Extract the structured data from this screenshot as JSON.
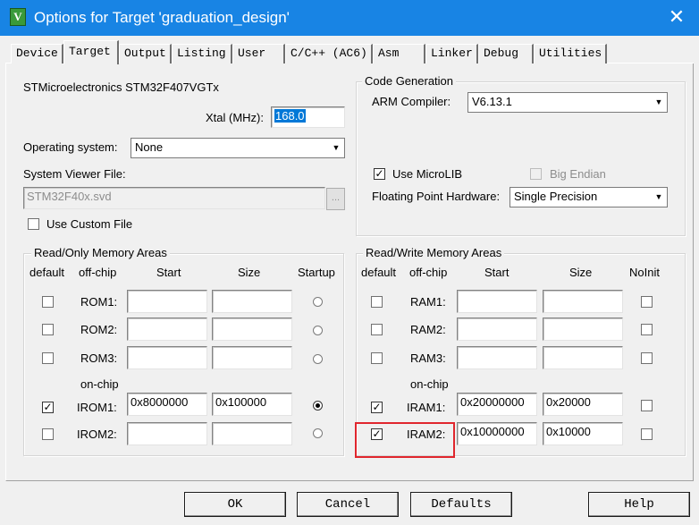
{
  "window": {
    "title": "Options for Target 'graduation_design'",
    "icon_letter": "V",
    "close_glyph": "✕"
  },
  "tabs": [
    "Device",
    "Target",
    "Output",
    "Listing",
    "User",
    "C/C++ (AC6)",
    "Asm",
    "Linker",
    "Debug",
    "Utilities"
  ],
  "active_tab": "Target",
  "device": {
    "name": "STMicroelectronics STM32F407VGTx",
    "xtal_label": "Xtal (MHz):",
    "xtal_value": "168.0",
    "os_label": "Operating system:",
    "os_value": "None",
    "viewer_label": "System Viewer File:",
    "viewer_value": "STM32F40x.svd",
    "browse_label": "...",
    "custom_file_label": "Use Custom File",
    "custom_file_checked": false
  },
  "code_generation": {
    "title": "Code Generation",
    "compiler_label": "ARM Compiler:",
    "compiler_value": "V6.13.1",
    "microlib_label": "Use MicroLIB",
    "microlib_checked": true,
    "big_endian_label": "Big Endian",
    "big_endian_checked": false,
    "fpu_label": "Floating Point Hardware:",
    "fpu_value": "Single Precision"
  },
  "rom_areas": {
    "title": "Read/Only Memory Areas",
    "headers": {
      "default": "default",
      "offchip": "off-chip",
      "start": "Start",
      "size": "Size",
      "startup": "Startup"
    },
    "onchip_label": "on-chip",
    "rows": [
      {
        "label": "ROM1:",
        "default": false,
        "start": "",
        "size": "",
        "startup": false
      },
      {
        "label": "ROM2:",
        "default": false,
        "start": "",
        "size": "",
        "startup": false
      },
      {
        "label": "ROM3:",
        "default": false,
        "start": "",
        "size": "",
        "startup": false
      },
      {
        "label": "IROM1:",
        "default": true,
        "start": "0x8000000",
        "size": "0x100000",
        "startup": true
      },
      {
        "label": "IROM2:",
        "default": false,
        "start": "",
        "size": "",
        "startup": false
      }
    ]
  },
  "ram_areas": {
    "title": "Read/Write Memory Areas",
    "headers": {
      "default": "default",
      "offchip": "off-chip",
      "start": "Start",
      "size": "Size",
      "noinit": "NoInit"
    },
    "onchip_label": "on-chip",
    "rows": [
      {
        "label": "RAM1:",
        "default": false,
        "start": "",
        "size": "",
        "noinit": false
      },
      {
        "label": "RAM2:",
        "default": false,
        "start": "",
        "size": "",
        "noinit": false
      },
      {
        "label": "RAM3:",
        "default": false,
        "start": "",
        "size": "",
        "noinit": false
      },
      {
        "label": "IRAM1:",
        "default": true,
        "start": "0x20000000",
        "size": "0x20000",
        "noinit": false
      },
      {
        "label": "IRAM2:",
        "default": true,
        "start": "0x10000000",
        "size": "0x10000",
        "noinit": false
      }
    ]
  },
  "buttons": {
    "ok": "OK",
    "cancel": "Cancel",
    "defaults": "Defaults",
    "help": "Help"
  },
  "colors": {
    "titlebar": "#1884e4",
    "highlight": "#e0262d",
    "selection": "#0078d7"
  }
}
